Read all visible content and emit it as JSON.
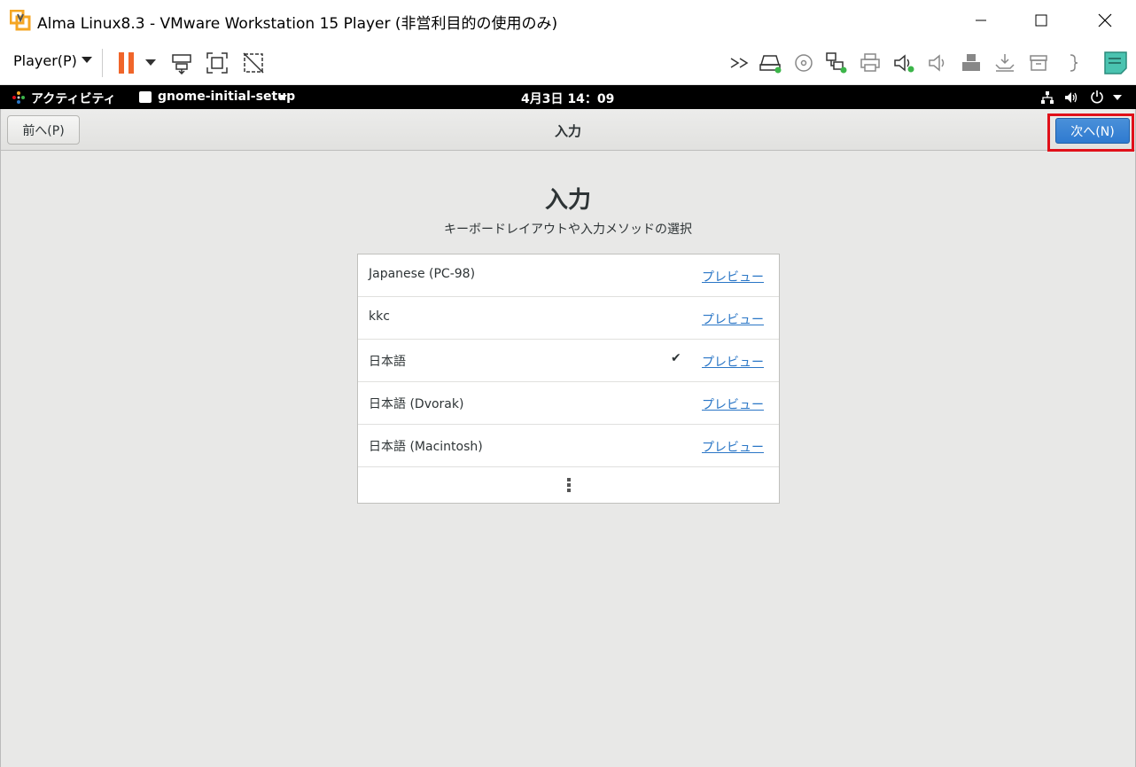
{
  "window": {
    "title": "Alma Linux8.3 - VMware Workstation 15 Player (非営利目的の使用のみ)"
  },
  "toolbar": {
    "player_label": "Player(P)"
  },
  "gnome_bar": {
    "activities": "アクティビティ",
    "app_menu": "gnome-initial-setup",
    "clock": "4月3日  14：09"
  },
  "header": {
    "prev_label": "前へ(P)",
    "title": "入力",
    "next_label": "次へ(N)"
  },
  "page": {
    "heading": "入力",
    "description": "キーボードレイアウトや入力メソッドの選択"
  },
  "input_sources": [
    {
      "label": "Japanese (PC-98)",
      "preview": "プレビュー",
      "selected": false
    },
    {
      "label": "kkc",
      "preview": "プレビュー",
      "selected": false
    },
    {
      "label": "日本語",
      "preview": "プレビュー",
      "selected": true,
      "check": "✔"
    },
    {
      "label": "日本語 (Dvorak)",
      "preview": "プレビュー",
      "selected": false
    },
    {
      "label": "日本語 (Macintosh)",
      "preview": "プレビュー",
      "selected": false
    }
  ],
  "colors": {
    "accent": "#2f7ad0",
    "highlight": "#e0101a",
    "link": "#2a76c6",
    "pause_orange": "#f0652a",
    "status_green": "#3cb54a"
  }
}
